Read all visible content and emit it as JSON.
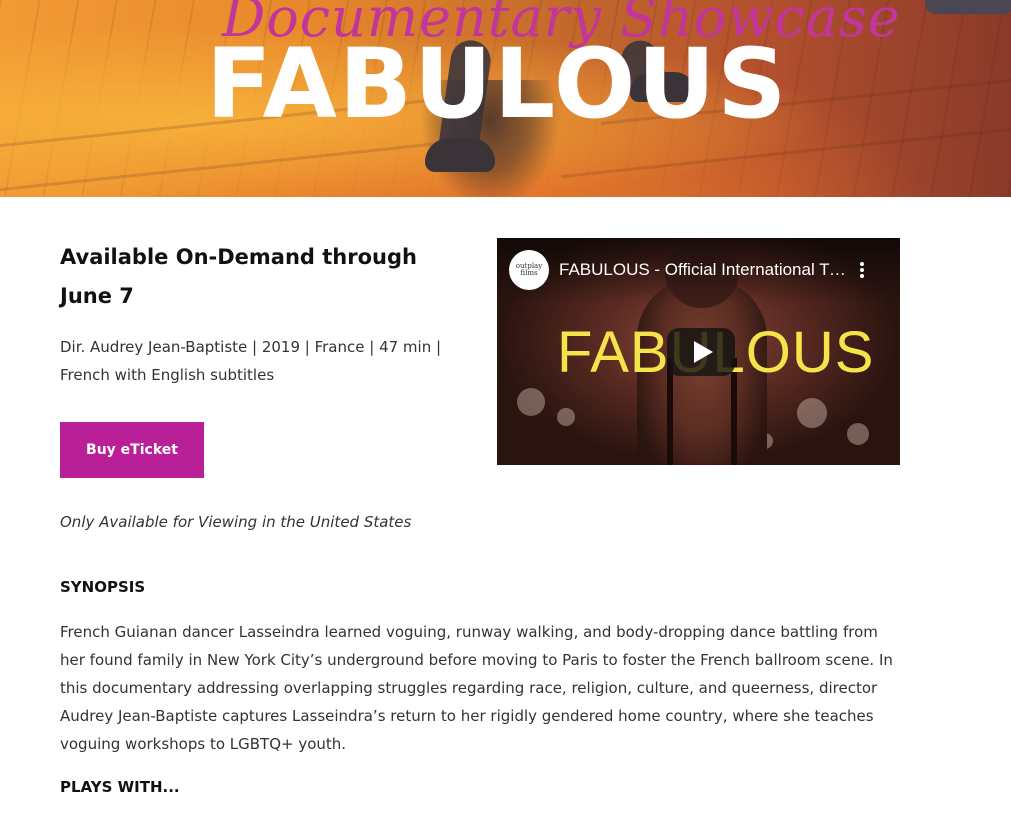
{
  "hero": {
    "script_title": "Documentary Showcase",
    "main_title": "FABULOUS"
  },
  "event": {
    "headline": "Available On-Demand through June 7",
    "meta": "Dir. Audrey Jean-Baptiste | 2019 | France | 47 min | French with English subtitles",
    "buy_label": "Buy eTicket",
    "availability": "Only Available for Viewing in the United States"
  },
  "video": {
    "channel_logo": "outplay films",
    "title": "FABULOUS - Official International Trailer",
    "poster_title": "FABULOUS",
    "menu_icon": "kebab-menu-icon",
    "play_icon": "play-icon"
  },
  "synopsis": {
    "heading": "SYNOPSIS",
    "body": "French Guianan dancer Lasseindra learned voguing, runway walking, and body-dropping dance battling from her found family in New York City’s underground before moving to Paris to foster the French ballroom scene. In this documentary addressing overlapping struggles regarding race, religion, culture, and queerness, director Audrey Jean-Baptiste captures Lasseindra’s return to her rigidly gendered home country, where she teaches voguing workshops to LGBTQ+ youth."
  },
  "plays_with": {
    "heading": "PLAYS WITH..."
  },
  "colors": {
    "accent": "#b91f97",
    "script_title": "#c2359c",
    "poster_title": "#f4e44a"
  }
}
